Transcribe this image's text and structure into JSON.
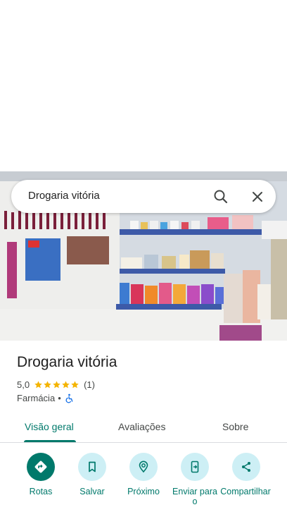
{
  "search": {
    "query": "Drogaria vitória"
  },
  "place": {
    "name": "Drogaria vitória",
    "rating": "5,0",
    "stars": 5,
    "review_count": "(1)",
    "category": "Farmácia",
    "separator": "•"
  },
  "tabs": [
    {
      "label": "Visão geral",
      "active": true
    },
    {
      "label": "Avaliações",
      "active": false
    },
    {
      "label": "Sobre",
      "active": false
    }
  ],
  "actions": [
    {
      "label": "Rotas",
      "icon": "directions-icon"
    },
    {
      "label": "Salvar",
      "icon": "bookmark-icon"
    },
    {
      "label": "Próximo",
      "icon": "nearby-icon"
    },
    {
      "label": "Enviar para o",
      "icon": "send-to-phone-icon"
    },
    {
      "label": "Compartilhar",
      "icon": "share-icon"
    }
  ],
  "colors": {
    "accent": "#00796b",
    "star": "#f4b400",
    "chip_bg": "#cdeff5"
  }
}
